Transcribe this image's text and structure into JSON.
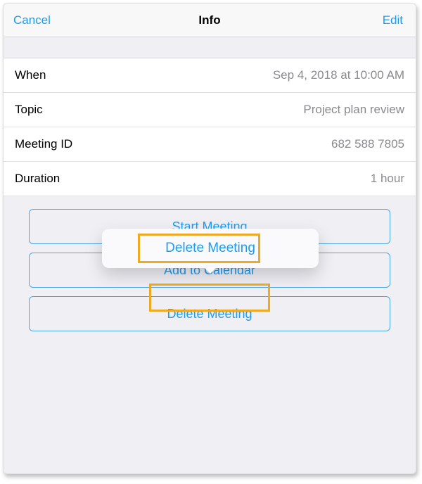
{
  "header": {
    "cancel": "Cancel",
    "title": "Info",
    "edit": "Edit"
  },
  "details": {
    "when_label": "When",
    "when_value": "Sep 4, 2018 at 10:00 AM",
    "topic_label": "Topic",
    "topic_value": "Project plan review",
    "meeting_id_label": "Meeting ID",
    "meeting_id_value": "682 588 7805",
    "duration_label": "Duration",
    "duration_value": "1 hour"
  },
  "actions": {
    "start": "Start Meeting",
    "add_calendar": "Add to Calendar",
    "delete": "Delete Meeting"
  },
  "popover": {
    "delete": "Delete Meeting"
  }
}
